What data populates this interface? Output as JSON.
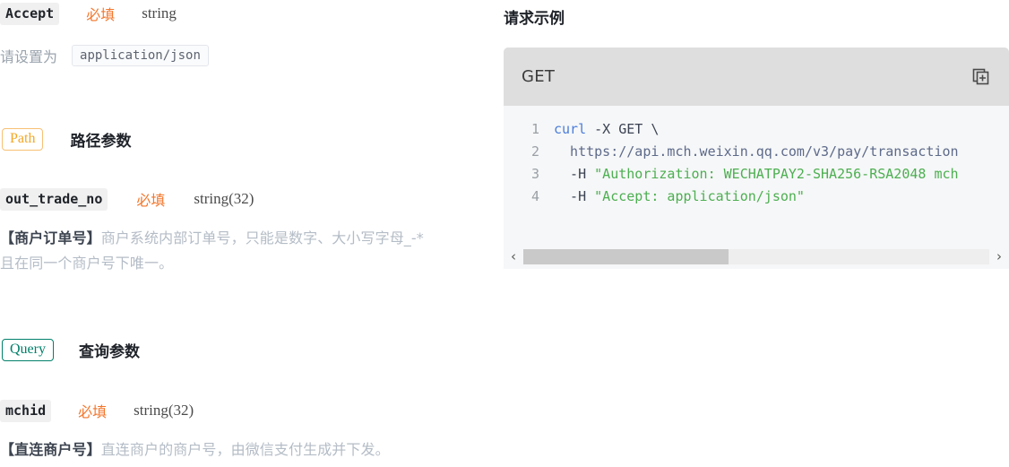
{
  "left": {
    "accept_param": {
      "name": "Accept",
      "required_label": "必填",
      "type": "string"
    },
    "accept_hint": {
      "prefix": "请设置为",
      "value": "application/json"
    },
    "path_section": {
      "badge": "Path",
      "title": "路径参数"
    },
    "out_trade_no": {
      "name": "out_trade_no",
      "required_label": "必填",
      "type": "string(32)",
      "desc_bold": "【商户订单号】",
      "desc_line1": "商户系统内部订单号，只能是数字、大小写字母_-*",
      "desc_line2": "且在同一个商户号下唯一。"
    },
    "query_section": {
      "badge": "Query",
      "title": "查询参数"
    },
    "mchid": {
      "name": "mchid",
      "required_label": "必填",
      "type": "string(32)",
      "desc_bold": "【直连商户号】",
      "desc_line1": "直连商户的商户号，由微信支付生成并下发。"
    }
  },
  "right": {
    "panel_title": "请求示例",
    "code_header": {
      "method": "GET",
      "copy_icon": "copy-icon"
    },
    "code_lines": [
      {
        "number": "1",
        "segments": [
          {
            "text": "curl",
            "cls": "tk-kw"
          },
          {
            "text": " -X GET \\",
            "cls": "tk-pl"
          }
        ]
      },
      {
        "number": "2",
        "segments": [
          {
            "text": "  https://api.mch.weixin.qq.com/v3/pay/transaction",
            "cls": "tk-url"
          }
        ]
      },
      {
        "number": "3",
        "segments": [
          {
            "text": "  -H ",
            "cls": "tk-pl"
          },
          {
            "text": "\"Authorization: WECHATPAY2-SHA256-RSA2048 mch",
            "cls": "tk-str"
          }
        ]
      },
      {
        "number": "4",
        "segments": [
          {
            "text": "  -H ",
            "cls": "tk-pl"
          },
          {
            "text": "\"Accept: application/json\"",
            "cls": "tk-str"
          }
        ]
      }
    ],
    "scrollbar": {
      "left_arrow": "‹",
      "right_arrow": "›",
      "thumb_position_pct": 0,
      "thumb_width_pct": 44
    }
  },
  "colors": {
    "required_orange": "#f3762b",
    "path_badge": "#f5a623",
    "query_badge": "#00806a",
    "code_string_green": "#4caf50",
    "code_keyword_blue": "#4a7ddb",
    "header_gray": "#dedede",
    "body_gray": "#f6f7f8"
  }
}
